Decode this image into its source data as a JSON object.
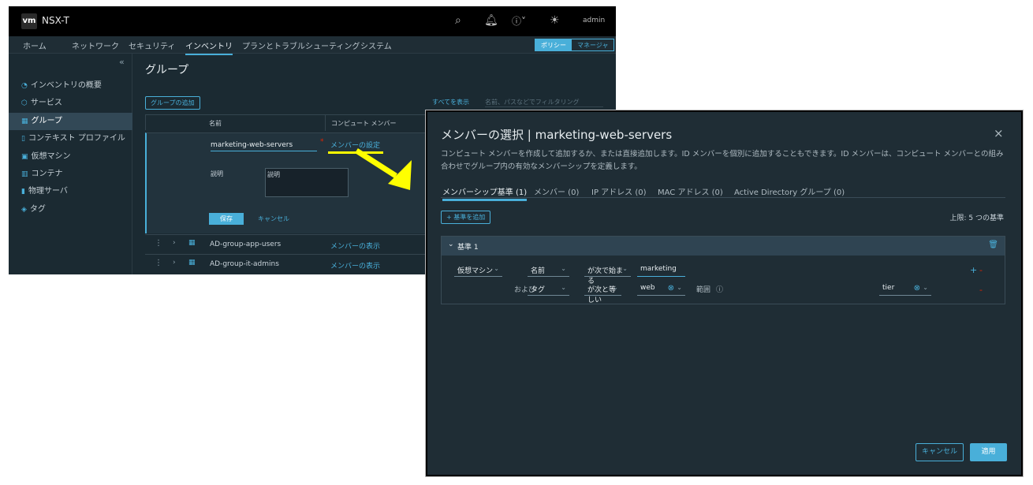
{
  "app": {
    "logo": "vm",
    "title": "NSX-T",
    "user": "admin"
  },
  "nav": {
    "items": [
      "ホーム",
      "ネットワーク",
      "セキュリティ",
      "インベントリ",
      "プランとトラブルシューティング",
      "システム"
    ],
    "toggle": [
      "ポリシー",
      "マネージャ"
    ]
  },
  "sidebar": {
    "collapse": "«",
    "items": [
      {
        "icon": "◔",
        "label": "インベントリの概要"
      },
      {
        "icon": "⬡",
        "label": "サービス"
      },
      {
        "icon": "▦",
        "label": "グループ"
      },
      {
        "icon": "▯",
        "label": "コンテキスト プロファイル"
      },
      {
        "icon": "▣",
        "label": "仮想マシン"
      },
      {
        "icon": "▥",
        "label": "コンテナ"
      },
      {
        "icon": "▮",
        "label": "物理サーバ"
      },
      {
        "icon": "◈",
        "label": "タグ"
      }
    ]
  },
  "groups": {
    "title": "グループ",
    "add_button": "グループの追加",
    "show_all": "すべてを表示",
    "filter_placeholder": "名前、パスなどでフィルタリング",
    "columns": [
      "名前",
      "コンピュート メンバー"
    ],
    "edit": {
      "name_value": "marketing-web-servers",
      "required": "*",
      "set_members": "メンバーの設定",
      "desc_label": "説明",
      "desc_placeholder": "説明",
      "save": "保存",
      "cancel": "キャンセル"
    },
    "rows": [
      {
        "name": "AD-group-app-users",
        "members": "メンバーの表示"
      },
      {
        "name": "AD-group-it-admins",
        "members": "メンバーの表示"
      }
    ]
  },
  "modal": {
    "title": "メンバーの選択 | marketing-web-servers",
    "description": "コンピュート メンバーを作成して追加するか、または直接追加します。ID メンバーを個別に追加することもできます。ID メンバーは、コンピュート メンバーとの組み合わせでグループ内の有効なメンバーシップを定義します。",
    "tabs": [
      "メンバーシップ基準 (1)",
      "メンバー (0)",
      "IP アドレス (0)",
      "MAC アドレス (0)",
      "Active Directory グループ (0)"
    ],
    "add_criteria": "+ 基準を追加",
    "limit": "上限: 5 つの基準",
    "criterion_title": "基準 1",
    "row1": {
      "type": "仮想マシン",
      "field": "名前",
      "op": "が次で始まる",
      "value": "marketing"
    },
    "row2": {
      "conj": "および",
      "field": "タグ",
      "op": "が次と等しい",
      "value": "web",
      "scope_label": "範囲",
      "scope": "tier"
    },
    "cancel": "キャンセル",
    "apply": "適用"
  },
  "colors": {
    "accent": "#49afd9",
    "highlight": "#ffff00",
    "danger": "#e12200"
  }
}
